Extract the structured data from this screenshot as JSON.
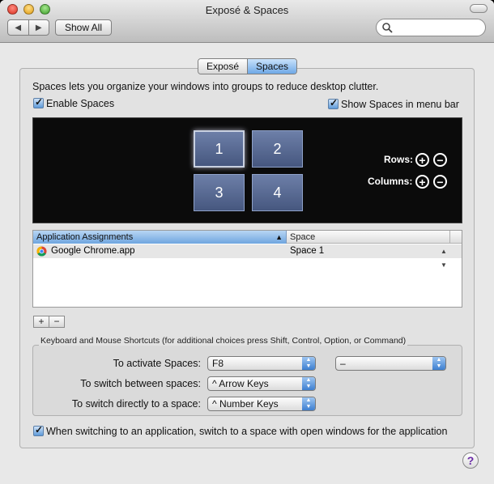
{
  "window": {
    "title": "Exposé & Spaces"
  },
  "toolbar": {
    "back_label": "◀",
    "forward_label": "▶",
    "show_all_label": "Show All",
    "search_value": "",
    "search_placeholder": ""
  },
  "tabs": [
    {
      "label": "Exposé",
      "selected": false
    },
    {
      "label": "Spaces",
      "selected": true
    }
  ],
  "description": "Spaces lets you organize your windows into groups to reduce desktop clutter.",
  "enable_spaces": {
    "label": "Enable Spaces",
    "checked": true
  },
  "show_in_menu_bar": {
    "label": "Show Spaces in menu bar",
    "checked": true
  },
  "spaces_grid": {
    "tiles": [
      "1",
      "2",
      "3",
      "4"
    ],
    "rows_label": "Rows:",
    "columns_label": "Columns:",
    "plus_symbol": "+",
    "minus_symbol": "−"
  },
  "assignments": {
    "columns": [
      "Application Assignments",
      "Space"
    ],
    "sort_indicator": "▲",
    "rows": [
      {
        "app": "Google Chrome.app",
        "space": "Space 1"
      }
    ],
    "add_label": "+",
    "remove_label": "−"
  },
  "shortcuts": {
    "title": "Keyboard and Mouse Shortcuts (for additional choices press Shift, Control, Option, or Command)",
    "activate_label": "To activate Spaces:",
    "activate_key": "F8",
    "activate_mouse": "–",
    "switch_between_label": "To switch between spaces:",
    "switch_between_value": "^ Arrow Keys",
    "switch_directly_label": "To switch directly to a space:",
    "switch_directly_value": "^ Number Keys"
  },
  "switch_to_space": {
    "label": "When switching to an application, switch to a space with open windows for the application",
    "checked": true
  },
  "help_label": "?"
}
